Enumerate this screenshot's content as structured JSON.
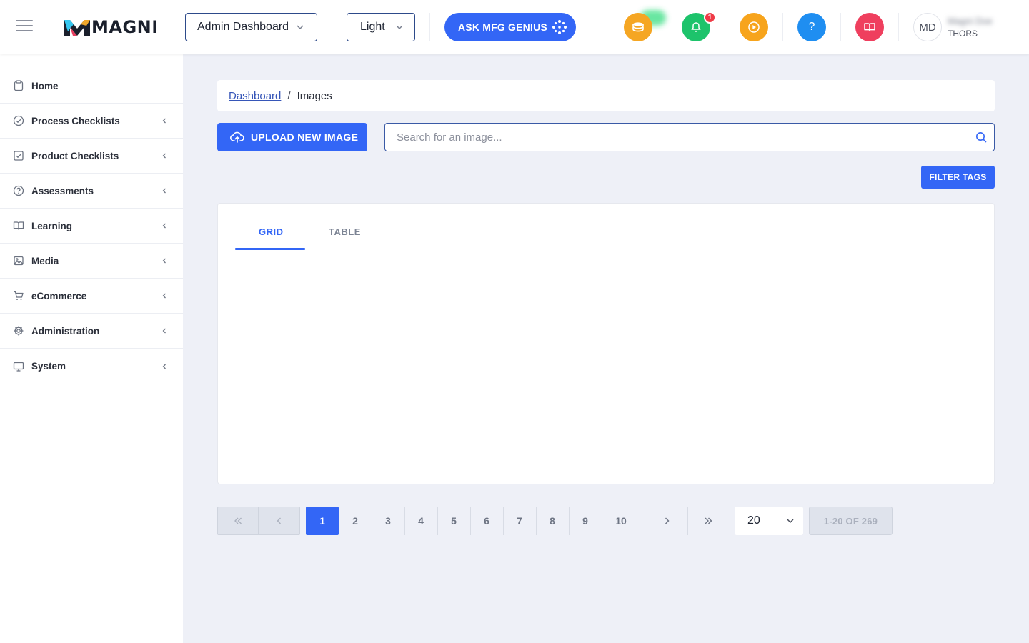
{
  "header": {
    "logo_text": "MAGNI",
    "dashboard_select": "Admin Dashboard",
    "theme_select": "Light",
    "ask_button": "ASK MFG GENIUS",
    "notification_count": "1",
    "help_glyph": "?",
    "user_initials": "MD",
    "user_name": "Magni Doe",
    "user_org": "THORS"
  },
  "colors": {
    "primary": "#3366f6",
    "coins": "#f5a623",
    "bell": "#1dc36b",
    "play": "#f7a41c",
    "help": "#1f8ef1",
    "book": "#ef3f5e"
  },
  "sidebar": {
    "items": [
      {
        "label": "Home",
        "icon": "clipboard-icon"
      },
      {
        "label": "Process Checklists",
        "icon": "check-circle-icon"
      },
      {
        "label": "Product Checklists",
        "icon": "check-square-icon"
      },
      {
        "label": "Assessments",
        "icon": "question-circle-icon"
      },
      {
        "label": "Learning",
        "icon": "book-icon"
      },
      {
        "label": "Media",
        "icon": "image-icon"
      },
      {
        "label": "eCommerce",
        "icon": "cart-icon"
      },
      {
        "label": "Administration",
        "icon": "gear-icon"
      },
      {
        "label": "System",
        "icon": "monitor-icon"
      }
    ]
  },
  "breadcrumb": {
    "parent": "Dashboard",
    "separator": "/",
    "current": "Images"
  },
  "toolbar": {
    "upload_label": "UPLOAD NEW IMAGE",
    "search_placeholder": "Search for an image...",
    "filter_label": "FILTER TAGS"
  },
  "tabs": [
    {
      "label": "GRID",
      "active": true
    },
    {
      "label": "TABLE",
      "active": false
    }
  ],
  "pagination": {
    "pages": [
      "1",
      "2",
      "3",
      "4",
      "5",
      "6",
      "7",
      "8",
      "9",
      "10"
    ],
    "current_page": "1",
    "per_page": "20",
    "range_text": "1-20 OF 269"
  }
}
